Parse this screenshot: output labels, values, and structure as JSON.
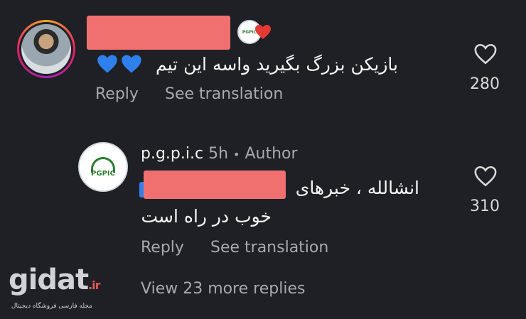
{
  "comment1": {
    "body": "بازیکن بزرگ بگیرید واسه این تیم",
    "emoji": "💙💙",
    "actions": {
      "reply": "Reply",
      "translate": "See translation"
    },
    "likes": "280",
    "badge_text": "PGPIC"
  },
  "comment2": {
    "username": "p.g.p.i.c",
    "time": "5h",
    "separator": "•",
    "role": "Author",
    "line1": "انشالله ، خبرهای",
    "line2": "خوب در راه است",
    "actions": {
      "reply": "Reply",
      "translate": "See translation"
    },
    "likes": "310",
    "avatar_text": "PGPIC"
  },
  "view_more": "View 23 more replies",
  "watermark": {
    "brand": "gidat",
    "tld": ".ir",
    "tagline": "مجله فارسی فروشگاه دیجیتال"
  },
  "colors": {
    "background": "#1f2025",
    "redaction": "#f07070",
    "muted": "#a8a9ad",
    "emoji_blue": "#2f80ed"
  }
}
